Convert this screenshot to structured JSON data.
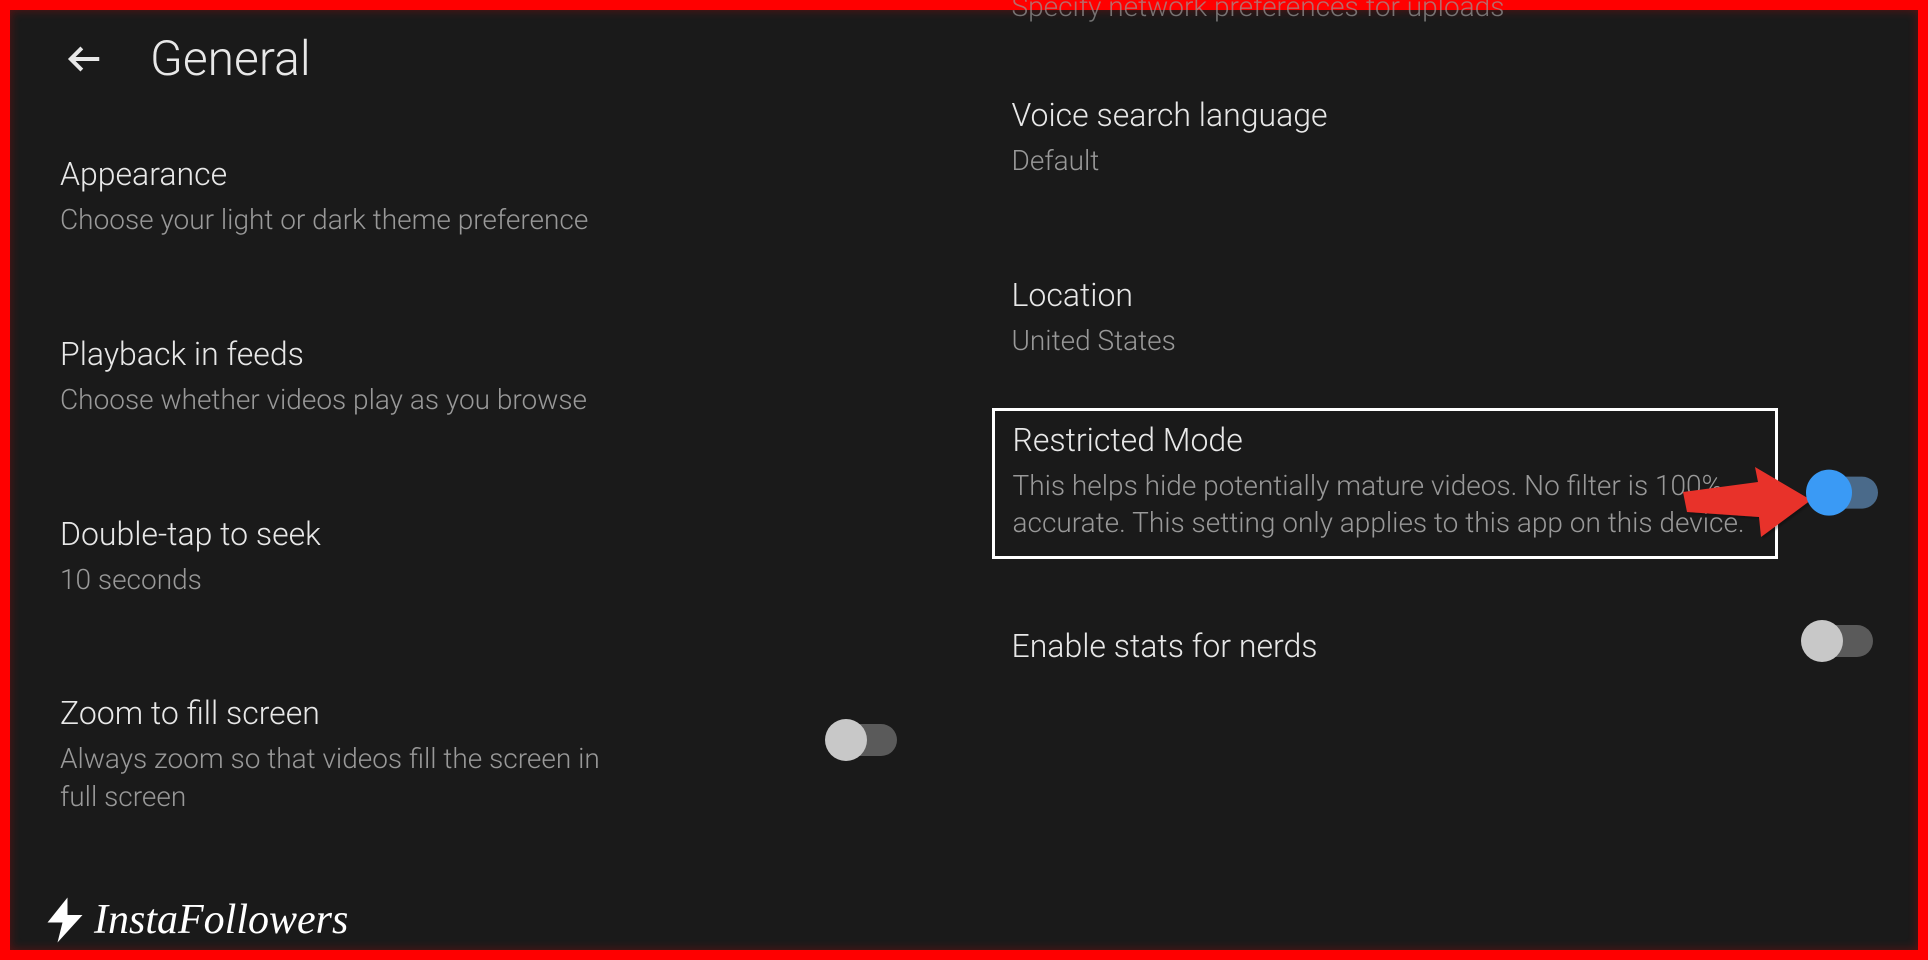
{
  "header": {
    "title": "General"
  },
  "left": {
    "appearance": {
      "title": "Appearance",
      "desc": "Choose your light or dark theme preference"
    },
    "playback": {
      "title": "Playback in feeds",
      "desc": "Choose whether videos play as you browse"
    },
    "doubletap": {
      "title": "Double-tap to seek",
      "desc": "10 seconds"
    },
    "zoom": {
      "title": "Zoom to fill screen",
      "desc": "Always zoom so that videos fill the screen in full screen",
      "toggle": false
    }
  },
  "right": {
    "partial_top": "Specify network preferences for uploads",
    "voice": {
      "title": "Voice search language",
      "desc": "Default"
    },
    "location": {
      "title": "Location",
      "desc": "United States"
    },
    "restricted": {
      "title": "Restricted Mode",
      "desc": "This helps hide potentially mature videos. No filter is 100% accurate. This setting only applies to this app on this device.",
      "toggle": true
    },
    "nerds": {
      "title": "Enable stats for nerds",
      "toggle": false
    }
  },
  "watermark": "InstaFollowers"
}
